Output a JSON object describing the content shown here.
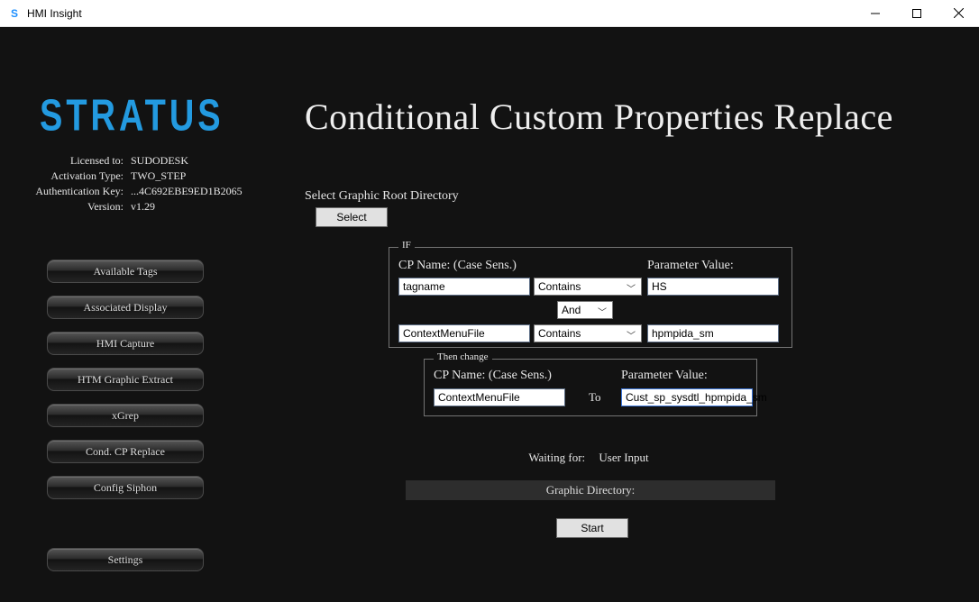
{
  "window": {
    "title": "HMI Insight"
  },
  "branding": {
    "logo_text": "STRATUS"
  },
  "license": {
    "licensed_to_label": "Licensed to:",
    "licensed_to_value": "SUDODESK",
    "activation_type_label": "Activation Type:",
    "activation_type_value": "TWO_STEP",
    "auth_key_label": "Authentication Key:",
    "auth_key_value": "...4C692EBE9ED1B2065",
    "version_label": "Version:",
    "version_value": "v1.29"
  },
  "nav": {
    "available_tags": "Available Tags",
    "associated_display": "Associated Display",
    "hmi_capture": "HMI Capture",
    "htm_graphic_extract": "HTM Graphic Extract",
    "xgrep": "xGrep",
    "cond_cp_replace": "Cond. CP Replace",
    "config_siphon": "Config Siphon",
    "settings": "Settings"
  },
  "main": {
    "title": "Conditional Custom Properties Replace",
    "select_root_label": "Select Graphic Root Directory",
    "select_button": "Select",
    "if": {
      "legend": "IF",
      "cpname_header": "CP Name: (Case Sens.)",
      "param_header": "Parameter Value:",
      "row1": {
        "cp_name": "tagname",
        "operator": "Contains",
        "value": "HS"
      },
      "logic_op": "And",
      "row2": {
        "cp_name": "ContextMenuFile",
        "operator": "Contains",
        "value": "hpmpida_sm"
      }
    },
    "then": {
      "legend": "Then change",
      "cpname_header": "CP Name: (Case Sens.)",
      "param_header": "Parameter Value:",
      "cp_name": "ContextMenuFile",
      "to_label": "To",
      "value": "Cust_sp_sysdtl_hpmpida_sm"
    },
    "status": {
      "label": "Waiting for:",
      "value": "User Input"
    },
    "dir_bar_label": "Graphic Directory:",
    "start_button": "Start"
  }
}
